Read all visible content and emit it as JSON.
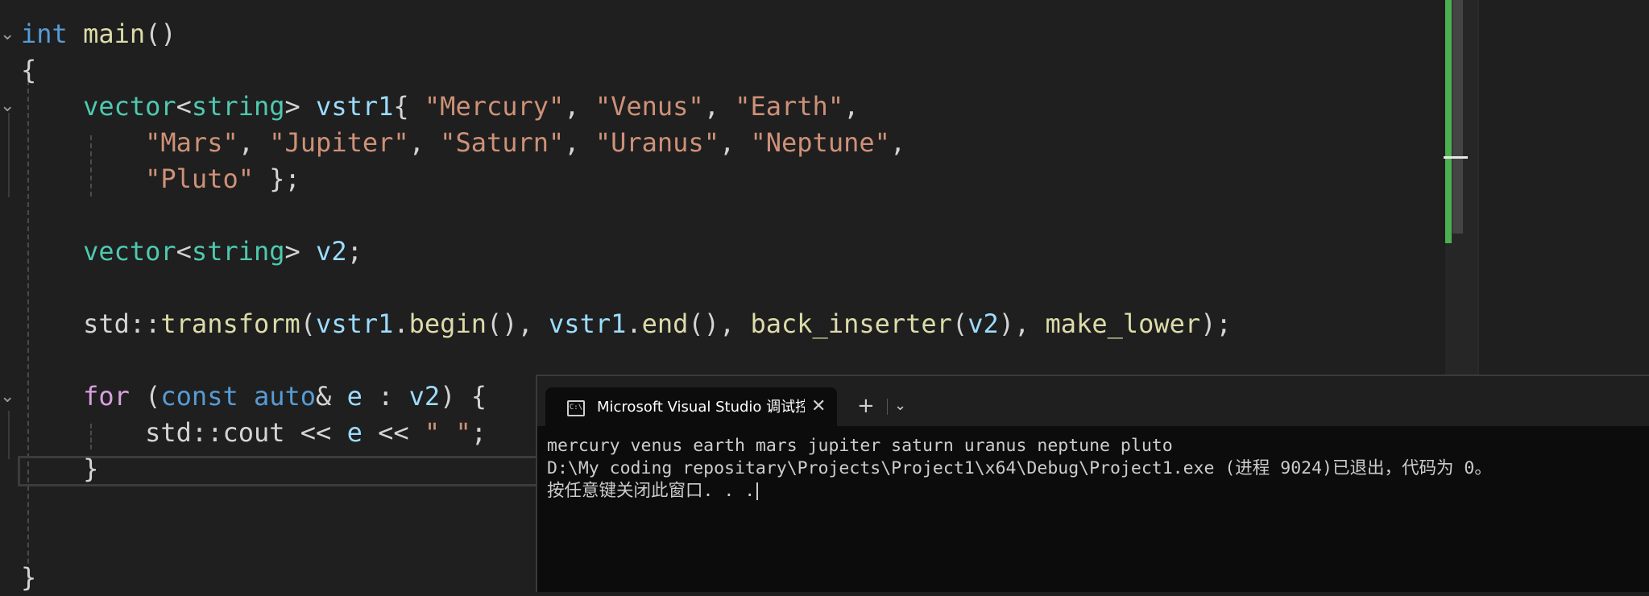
{
  "editor": {
    "code_lines": [
      {
        "tokens": [
          {
            "t": "int",
            "c": "kw"
          },
          {
            "t": " ",
            "c": "pun"
          },
          {
            "t": "main",
            "c": "fn"
          },
          {
            "t": "()",
            "c": "pun"
          }
        ]
      },
      {
        "tokens": [
          {
            "t": "{",
            "c": "pun"
          }
        ]
      },
      {
        "tokens": [
          {
            "t": "    ",
            "c": "pun"
          },
          {
            "t": "vector",
            "c": "type"
          },
          {
            "t": "<",
            "c": "pun"
          },
          {
            "t": "string",
            "c": "type"
          },
          {
            "t": "> ",
            "c": "pun"
          },
          {
            "t": "vstr1",
            "c": "var"
          },
          {
            "t": "{ ",
            "c": "pun"
          },
          {
            "t": "\"Mercury\"",
            "c": "str"
          },
          {
            "t": ", ",
            "c": "pun"
          },
          {
            "t": "\"Venus\"",
            "c": "str"
          },
          {
            "t": ", ",
            "c": "pun"
          },
          {
            "t": "\"Earth\"",
            "c": "str"
          },
          {
            "t": ",",
            "c": "pun"
          }
        ]
      },
      {
        "tokens": [
          {
            "t": "        ",
            "c": "pun"
          },
          {
            "t": "\"Mars\"",
            "c": "str"
          },
          {
            "t": ", ",
            "c": "pun"
          },
          {
            "t": "\"Jupiter\"",
            "c": "str"
          },
          {
            "t": ", ",
            "c": "pun"
          },
          {
            "t": "\"Saturn\"",
            "c": "str"
          },
          {
            "t": ", ",
            "c": "pun"
          },
          {
            "t": "\"Uranus\"",
            "c": "str"
          },
          {
            "t": ", ",
            "c": "pun"
          },
          {
            "t": "\"Neptune\"",
            "c": "str"
          },
          {
            "t": ",",
            "c": "pun"
          }
        ]
      },
      {
        "tokens": [
          {
            "t": "        ",
            "c": "pun"
          },
          {
            "t": "\"Pluto\"",
            "c": "str"
          },
          {
            "t": " };",
            "c": "pun"
          }
        ]
      },
      {
        "tokens": []
      },
      {
        "tokens": [
          {
            "t": "    ",
            "c": "pun"
          },
          {
            "t": "vector",
            "c": "type"
          },
          {
            "t": "<",
            "c": "pun"
          },
          {
            "t": "string",
            "c": "type"
          },
          {
            "t": "> ",
            "c": "pun"
          },
          {
            "t": "v2",
            "c": "var"
          },
          {
            "t": ";",
            "c": "pun"
          }
        ]
      },
      {
        "tokens": []
      },
      {
        "tokens": [
          {
            "t": "    ",
            "c": "pun"
          },
          {
            "t": "std",
            "c": "pun"
          },
          {
            "t": "::",
            "c": "pun"
          },
          {
            "t": "transform",
            "c": "fn"
          },
          {
            "t": "(",
            "c": "pun"
          },
          {
            "t": "vstr1",
            "c": "var"
          },
          {
            "t": ".",
            "c": "pun"
          },
          {
            "t": "begin",
            "c": "fn"
          },
          {
            "t": "(), ",
            "c": "pun"
          },
          {
            "t": "vstr1",
            "c": "var"
          },
          {
            "t": ".",
            "c": "pun"
          },
          {
            "t": "end",
            "c": "fn"
          },
          {
            "t": "(), ",
            "c": "pun"
          },
          {
            "t": "back_inserter",
            "c": "fn"
          },
          {
            "t": "(",
            "c": "pun"
          },
          {
            "t": "v2",
            "c": "var"
          },
          {
            "t": "), ",
            "c": "pun"
          },
          {
            "t": "make_lower",
            "c": "fn"
          },
          {
            "t": ");",
            "c": "pun"
          }
        ]
      },
      {
        "tokens": []
      },
      {
        "tokens": [
          {
            "t": "    ",
            "c": "pun"
          },
          {
            "t": "for",
            "c": "ctl"
          },
          {
            "t": " (",
            "c": "pun"
          },
          {
            "t": "const",
            "c": "kw"
          },
          {
            "t": " ",
            "c": "pun"
          },
          {
            "t": "auto",
            "c": "kw"
          },
          {
            "t": "& ",
            "c": "pun"
          },
          {
            "t": "e",
            "c": "var"
          },
          {
            "t": " : ",
            "c": "pun"
          },
          {
            "t": "v2",
            "c": "var"
          },
          {
            "t": ") {",
            "c": "pun"
          }
        ]
      },
      {
        "tokens": [
          {
            "t": "        ",
            "c": "pun"
          },
          {
            "t": "std",
            "c": "pun"
          },
          {
            "t": "::",
            "c": "pun"
          },
          {
            "t": "cout",
            "c": "pun"
          },
          {
            "t": " << ",
            "c": "pun"
          },
          {
            "t": "e",
            "c": "var"
          },
          {
            "t": " << ",
            "c": "pun"
          },
          {
            "t": "\" \"",
            "c": "str"
          },
          {
            "t": ";",
            "c": "pun"
          }
        ]
      },
      {
        "tokens": [
          {
            "t": "    ",
            "c": "pun"
          },
          {
            "t": "}",
            "c": "pun"
          }
        ]
      },
      {
        "tokens": []
      },
      {
        "tokens": []
      },
      {
        "tokens": [
          {
            "t": "}",
            "c": "pun"
          }
        ]
      }
    ],
    "fold_icon": "chevron-down-icon"
  },
  "colors": {
    "editor_bg": "#1f1f1f",
    "keyword": "#569cd6",
    "control": "#d8a0df",
    "type": "#4ec9b0",
    "variable": "#9cdcfe",
    "string": "#ce9178",
    "function": "#dcdcaa",
    "change_marker": "#4caf50",
    "console_bg": "#0c0c0c"
  },
  "console": {
    "tab_title": "Microsoft Visual Studio 调试控制台",
    "tab_icon": "terminal-icon",
    "close_glyph": "✕",
    "new_tab_glyph": "+",
    "menu_glyph": "⌄",
    "output_lines": [
      "mercury venus earth mars jupiter saturn uranus neptune pluto",
      "D:\\My coding repositary\\Projects\\Project1\\x64\\Debug\\Project1.exe (进程 9024)已退出，代码为 0。",
      "按任意键关闭此窗口. . ."
    ]
  }
}
